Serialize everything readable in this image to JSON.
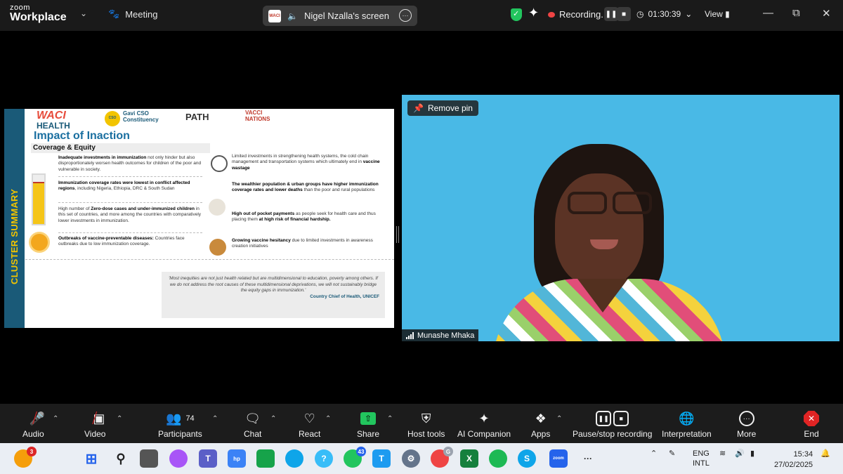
{
  "app": {
    "logo_line1": "zoom",
    "logo_line2": "Workplace",
    "meeting_label": "Meeting",
    "screen_label": "Nigel Nzalla's screen",
    "recording_label": "Recording...",
    "timer": "01:30:39",
    "view_label": "View"
  },
  "slide": {
    "sidebar_text": "CLUSTER SUMMARY",
    "logos": {
      "waci_a": "WACI",
      "waci_b": "HEALTH",
      "gavi": "Gavi CSO Constituency",
      "path": "PATH",
      "vacci_a": "VACCI",
      "vacci_b": "NATIONS"
    },
    "title": "Impact of Inaction",
    "subtitle": "Coverage & Equity",
    "left_items": [
      {
        "bold": "Inadequate investments in immunization",
        "text": " not only hinder but also disproportionately worsen health outcomes for children of the poor and vulnerable in society."
      },
      {
        "bold": "Immunization coverage rates were lowest in conflict affected regions",
        "text": ", including Nigeria, Ethiopia, DRC & South Sudan"
      },
      {
        "bold": "Zero-dose cases and under-immunized children",
        "text_pre": "High number of ",
        "text": " in this set of countries, and more among the countries with comparatively lower investments in immunization."
      },
      {
        "bold": "Outbreaks of vaccine-preventable diseases:",
        "text": " Countries face outbreaks due to low immunization coverage."
      }
    ],
    "right_items": [
      {
        "text": "Limited investments in strengthening health systems, the cold chain management and transportation systems which ultimately end in ",
        "bold": "vaccine wastage"
      },
      {
        "bold": "The wealthier population & urban groups have higher immunization coverage rates and lower deaths",
        "text": " than the poor and rural populations"
      },
      {
        "bold": "High out of pocket payments",
        "text": " as people seek for health care and thus placing them ",
        "bold2": "at high risk of financial hardship."
      },
      {
        "bold": "Growing vaccine hesitancy",
        "text": " due to limited investments in awareness creation initiatives"
      }
    ],
    "quote": "'Most inequities are not just health related but are multidimensional to education, poverty among others. If we do not address the root causes of these multidimensional deprivations, we will not sustainably bridge the equity gaps in immunization.'",
    "quote_by": "Country Chief of Health, UNICEF"
  },
  "video": {
    "remove_pin": "Remove pin",
    "participant_name": "Munashe Mhaka"
  },
  "toolbar": {
    "audio": "Audio",
    "video": "Video",
    "participants": "Participants",
    "participants_count": "74",
    "chat": "Chat",
    "react": "React",
    "share": "Share",
    "host_tools": "Host tools",
    "ai_companion": "AI Companion",
    "apps": "Apps",
    "pause_stop": "Pause/stop recording",
    "interpretation": "Interpretation",
    "more": "More",
    "end": "End"
  },
  "taskbar": {
    "weather_badge": "3",
    "whatsapp_badge": "43",
    "chrome_badge": "G",
    "lang_1": "ENG",
    "lang_2": "INTL",
    "time": "15:34",
    "date": "27/02/2025"
  }
}
